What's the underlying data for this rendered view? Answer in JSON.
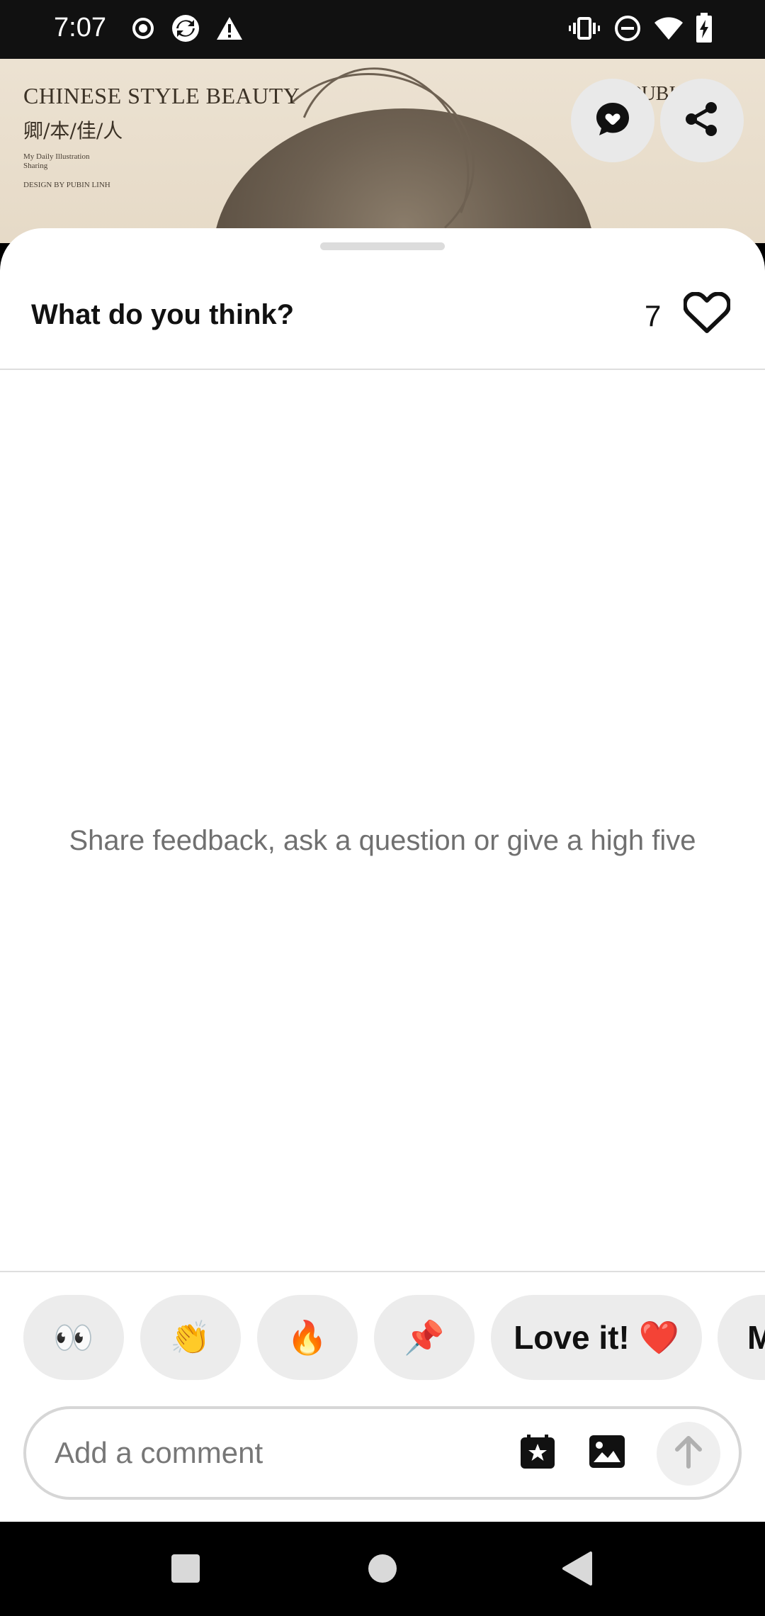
{
  "status_bar": {
    "time": "7:07",
    "left_icons": [
      "radio-icon",
      "sync-icon",
      "alert-icon"
    ],
    "right_icons": [
      "vibrate-icon",
      "do-not-disturb-icon",
      "wifi-icon",
      "battery-charging-icon"
    ]
  },
  "pin_image": {
    "title_en": "CHINESE STYLE BEAUTY",
    "title_cn": "卿/本/佳/人",
    "subtitle_line1": "My Daily Illustration",
    "subtitle_line2": "Sharing",
    "credit": "DESIGN BY PUBIN LINH",
    "right_text": "PUBI C"
  },
  "actions": {
    "message_icon": "message-icon",
    "share_icon": "share-icon"
  },
  "sheet": {
    "title": "What do you think?",
    "like_count": "7",
    "heart_icon": "heart-outline-icon",
    "empty_message": "Share feedback, ask a question or give a high five"
  },
  "reactions": [
    {
      "label": "👀"
    },
    {
      "label": "👏"
    },
    {
      "label": "🔥"
    },
    {
      "label": "📌"
    },
    {
      "label": "Love it! ❤️"
    },
    {
      "label": "M"
    }
  ],
  "comment": {
    "placeholder": "Add a comment",
    "value": "",
    "sticker_icon": "sticker-star-icon",
    "image_icon": "image-icon",
    "send_icon": "arrow-up-icon"
  },
  "nav": {
    "recents_icon": "recents-square-icon",
    "home_icon": "home-circle-icon",
    "back_icon": "back-triangle-icon"
  }
}
